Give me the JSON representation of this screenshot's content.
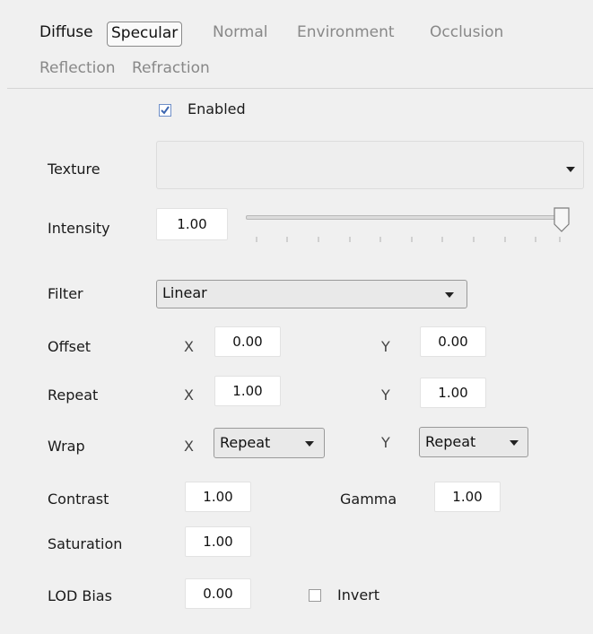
{
  "tabs": [
    "Diffuse",
    "Specular",
    "Normal",
    "Environment",
    "Occlusion",
    "Reflection",
    "Refraction"
  ],
  "enabled": {
    "label": "Enabled",
    "checked": true
  },
  "texture": {
    "label": "Texture",
    "value": ""
  },
  "intensity": {
    "label": "Intensity",
    "value": "1.00",
    "slider_level": 1.0
  },
  "filter": {
    "label": "Filter",
    "value": "Linear"
  },
  "offset": {
    "label": "Offset",
    "x_label": "X",
    "x": "0.00",
    "y_label": "Y",
    "y": "0.00"
  },
  "repeat": {
    "label": "Repeat",
    "x_label": "X",
    "x": "1.00",
    "y_label": "Y",
    "y": "1.00"
  },
  "wrap": {
    "label": "Wrap",
    "x_label": "X",
    "x": "Repeat",
    "y_label": "Y",
    "y": "Repeat"
  },
  "contrast": {
    "label": "Contrast",
    "value": "1.00"
  },
  "gamma": {
    "label": "Gamma",
    "value": "1.00"
  },
  "saturation": {
    "label": "Saturation",
    "value": "1.00"
  },
  "lod_bias": {
    "label": "LOD Bias",
    "value": "0.00"
  },
  "invert": {
    "label": "Invert",
    "checked": false
  },
  "colors": {
    "check_blue": "#3c66b0",
    "tab_inactive": "#888888",
    "text": "#1a1a1a"
  }
}
